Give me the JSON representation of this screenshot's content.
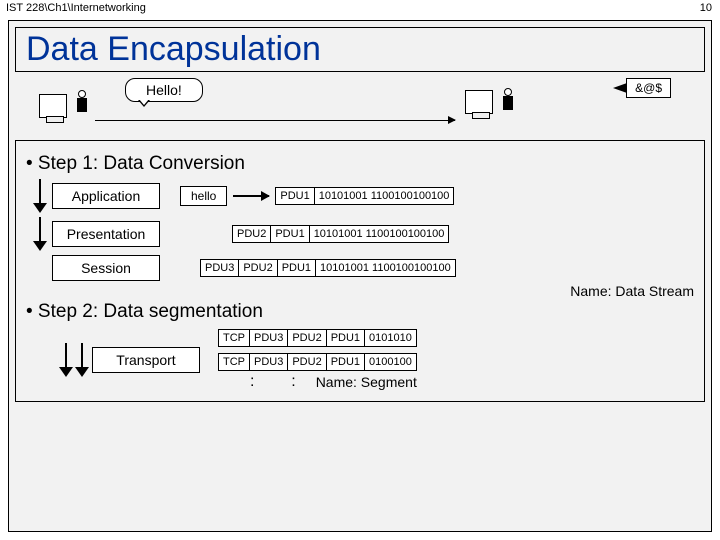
{
  "header": {
    "path": "IST 228\\Ch1\\Internetworking",
    "pageNum": "10"
  },
  "title": "Data Encapsulation",
  "speech": {
    "hello": "Hello!",
    "garble": "&@$"
  },
  "step1": {
    "bullet": "• Step 1: Data Conversion",
    "layers": {
      "app": "Application",
      "pres": "Presentation",
      "sess": "Session"
    },
    "hello_data": "hello",
    "pdu1": "PDU1",
    "pdu2": "PDU2",
    "pdu3": "PDU3",
    "binary": "10101001 1100100100100",
    "streamLabel": "Name: Data Stream"
  },
  "step2": {
    "bullet": "• Step 2: Data segmentation",
    "layer": "Transport",
    "tcp": "TCP",
    "pdu1": "PDU1",
    "pdu2": "PDU2",
    "pdu3": "PDU3",
    "bin1": "0101010",
    "bin2": "0100100",
    "dots": ":",
    "segLabel": "Name: Segment"
  }
}
